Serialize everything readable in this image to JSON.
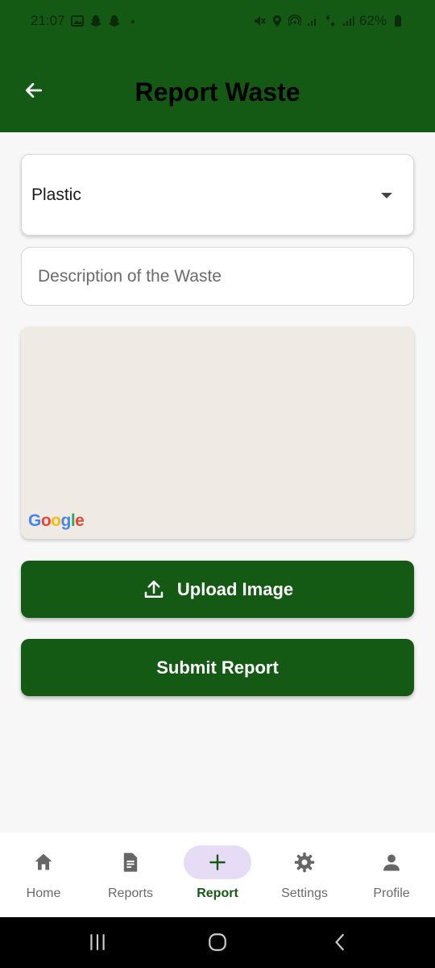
{
  "status_bar": {
    "time": "21:07",
    "battery": "62%"
  },
  "app_bar": {
    "title": "Report Waste",
    "back_icon": "arrow-left-icon"
  },
  "form": {
    "waste_type": "Plastic",
    "description_placeholder": "Description of the Waste",
    "description_value": ""
  },
  "map": {
    "attribution_letters": [
      "G",
      "o",
      "o",
      "g",
      "l",
      "e"
    ]
  },
  "buttons": {
    "upload_label": "Upload Image",
    "submit_label": "Submit Report"
  },
  "bottom_nav": {
    "items": [
      {
        "label": "Home",
        "icon": "home-icon"
      },
      {
        "label": "Reports",
        "icon": "document-icon"
      },
      {
        "label": "Report",
        "icon": "plus-icon",
        "active": true
      },
      {
        "label": "Settings",
        "icon": "gear-icon"
      },
      {
        "label": "Profile",
        "icon": "person-icon"
      }
    ]
  },
  "colors": {
    "primary": "#145a14",
    "nav_active_pill": "#e6dcf5",
    "map_bg": "#efebe4"
  }
}
